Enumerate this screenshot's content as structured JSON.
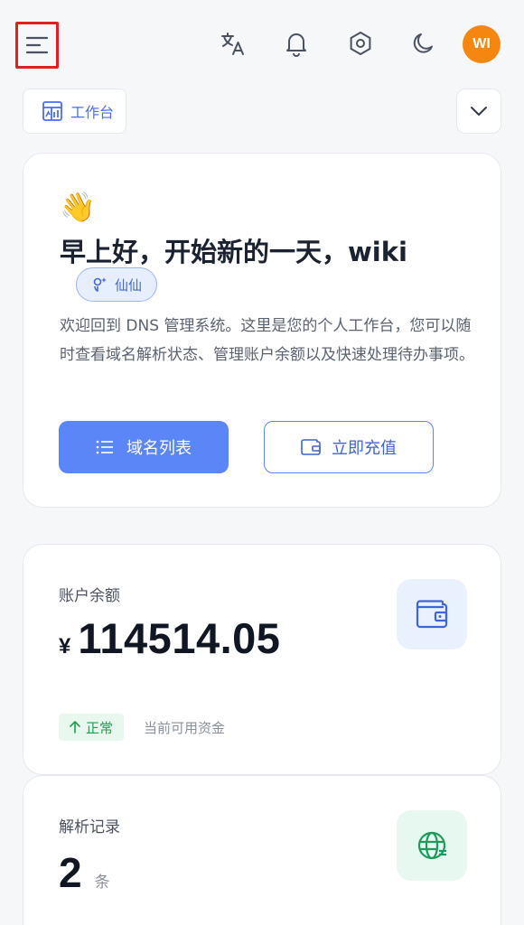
{
  "header": {
    "avatar_initials": "WI",
    "icons": [
      "menu-icon",
      "translate-icon",
      "bell-icon",
      "settings-hexagon-icon",
      "moon-icon"
    ]
  },
  "tabs": {
    "active_label": "工作台"
  },
  "welcome": {
    "emoji": "👋",
    "greeting": "早上好，开始新的一天，wiki",
    "role": "仙仙",
    "description": "欢迎回到 DNS 管理系统。这里是您的个人工作台，您可以随时查看域名解析状态、管理账户余额以及快速处理待办事项。",
    "primary_button": "域名列表",
    "secondary_button": "立即充值"
  },
  "balance": {
    "label": "账户余额",
    "currency": "¥",
    "value": "114514.05",
    "status": "正常",
    "note": "当前可用资金"
  },
  "records": {
    "label": "解析记录",
    "value": "2",
    "unit": "条"
  },
  "colors": {
    "primary": "#5b86f7",
    "avatar": "#f5860f",
    "success": "#1f9d4d",
    "highlight": "#e02020"
  }
}
